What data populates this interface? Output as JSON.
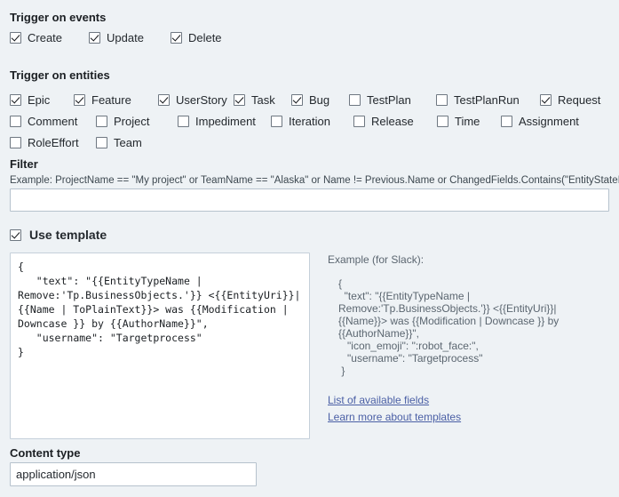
{
  "events": {
    "title": "Trigger on events",
    "items": [
      {
        "label": "Create",
        "checked": true
      },
      {
        "label": "Update",
        "checked": true
      },
      {
        "label": "Delete",
        "checked": true
      }
    ]
  },
  "entities": {
    "title": "Trigger on entities",
    "rows": [
      [
        {
          "label": "Epic",
          "checked": true
        },
        {
          "label": "Feature",
          "checked": true
        },
        {
          "label": "UserStory",
          "checked": true
        },
        {
          "label": "Task",
          "checked": true
        },
        {
          "label": "Bug",
          "checked": true
        },
        {
          "label": "TestPlan",
          "checked": false
        },
        {
          "label": "TestPlanRun",
          "checked": false
        },
        {
          "label": "Request",
          "checked": true
        }
      ],
      [
        {
          "label": "Comment",
          "checked": false
        },
        {
          "label": "Project",
          "checked": false
        },
        {
          "label": "Impediment",
          "checked": false
        },
        {
          "label": "Iteration",
          "checked": false
        },
        {
          "label": "Release",
          "checked": false
        },
        {
          "label": "Time",
          "checked": false
        },
        {
          "label": "Assignment",
          "checked": false
        }
      ],
      [
        {
          "label": "RoleEffort",
          "checked": false
        },
        {
          "label": "Team",
          "checked": false
        }
      ]
    ]
  },
  "filter": {
    "title": "Filter",
    "example": "Example: ProjectName == \"My project\" or TeamName == \"Alaska\" or Name != Previous.Name or ChangedFields.Contains(\"EntityStateID\")",
    "value": "",
    "placeholder": ""
  },
  "use_template": {
    "label": "Use template",
    "checked": true
  },
  "template": {
    "value": "{\n   \"text\": \"{{EntityTypeName |\nRemove:'Tp.BusinessObjects.'}} <{{EntityUri}}|\n{{Name | ToPlainText}}> was {{Modification |\nDowncase }} by {{AuthorName}}\",\n   \"username\": \"Targetprocess\"\n}",
    "placeholder": ""
  },
  "example_panel": {
    "heading": "Example (for Slack):",
    "code": "{\n  \"text\": \"{{EntityTypeName |\nRemove:'Tp.BusinessObjects.'}} <{{EntityUri}}|\n{{Name}}> was {{Modification | Downcase }} by\n{{AuthorName}}\",\n   \"icon_emoji\": \":robot_face:\",\n   \"username\": \"Targetprocess\"\n }",
    "links": [
      "List of available fields",
      "Learn more about templates"
    ]
  },
  "content_type": {
    "title": "Content type",
    "value": "application/json",
    "placeholder": ""
  },
  "colors": {
    "page_background": "#eef2f5",
    "field_background": "#ffffff",
    "field_border": "#b6c2cd",
    "text": "#24292e",
    "muted_text": "#5b6670",
    "link": "#4a5fa5"
  }
}
